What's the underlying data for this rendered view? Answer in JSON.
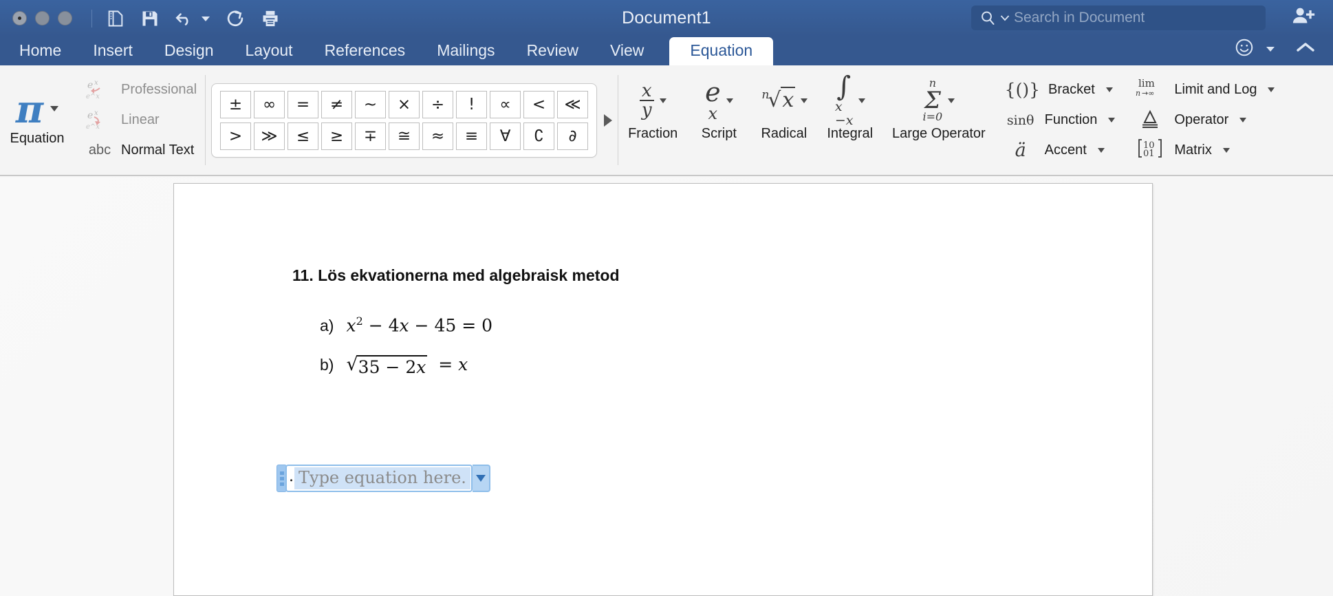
{
  "titlebar": {
    "document_title": "Document1",
    "window_controls": [
      "close",
      "minimize",
      "zoom"
    ],
    "quick_access": [
      {
        "name": "sidebar-toggle-icon",
        "label": "Sidebar"
      },
      {
        "name": "save-icon",
        "label": "Save"
      },
      {
        "name": "undo-icon",
        "label": "Undo"
      },
      {
        "name": "undo-dropdown-icon",
        "label": "Undo options"
      },
      {
        "name": "redo-icon",
        "label": "Redo"
      },
      {
        "name": "print-icon",
        "label": "Print"
      }
    ],
    "search": {
      "placeholder": "Search in Document",
      "value": "",
      "icon": "search-icon",
      "dropdown_icon": "chevron-down-icon"
    },
    "share_icon": "person-add-icon"
  },
  "tabs": {
    "items": [
      {
        "label": "Home",
        "active": false
      },
      {
        "label": "Insert",
        "active": false
      },
      {
        "label": "Design",
        "active": false
      },
      {
        "label": "Layout",
        "active": false
      },
      {
        "label": "References",
        "active": false
      },
      {
        "label": "Mailings",
        "active": false
      },
      {
        "label": "Review",
        "active": false
      },
      {
        "label": "View",
        "active": false
      },
      {
        "label": "Equation",
        "active": true
      }
    ],
    "right_icons": [
      {
        "name": "smiley-feedback-icon"
      },
      {
        "name": "chevron-down-icon"
      },
      {
        "name": "ribbon-collapse-chevron-icon"
      }
    ]
  },
  "ribbon": {
    "tools_group": {
      "equation_button": {
        "label": "Equation",
        "glyph": "π",
        "has_dropdown": true
      },
      "conversions": [
        {
          "label": "Professional",
          "icon": "professional-convert-icon",
          "enabled": false
        },
        {
          "label": "Linear",
          "icon": "linear-convert-icon",
          "enabled": false
        },
        {
          "label": "Normal Text",
          "icon": "abc-icon",
          "enabled": true
        }
      ]
    },
    "symbols_group": {
      "row1": [
        "±",
        "∞",
        "=",
        "≠",
        "~",
        "×",
        "÷",
        "!",
        "∝",
        "<",
        "≪"
      ],
      "row2": [
        ">",
        "≫",
        "≤",
        "≥",
        "∓",
        "≅",
        "≈",
        "≡",
        "∀",
        "∁",
        "∂"
      ],
      "more_icon": "gallery-more-arrow-icon"
    },
    "structures_group": {
      "large_buttons": [
        {
          "label": "Fraction",
          "glyph_type": "fraction",
          "numerator": "x",
          "denominator": "y",
          "has_dropdown": true
        },
        {
          "label": "Script",
          "glyph_type": "superscript",
          "base": "e",
          "exponent": "x",
          "has_dropdown": true
        },
        {
          "label": "Radical",
          "glyph_type": "radical",
          "index": "n",
          "radicand": "x",
          "has_dropdown": true
        },
        {
          "label": "Integral",
          "glyph_type": "integral",
          "upper": "x",
          "lower": "−x",
          "has_dropdown": true
        },
        {
          "label": "Large Operator",
          "glyph_type": "summation",
          "upper": "n",
          "lower": "i=0",
          "has_dropdown": true
        }
      ],
      "small_buttons": [
        {
          "label": "Bracket",
          "icon": "{()}",
          "has_dropdown": true
        },
        {
          "label": "Function",
          "icon": "sinθ",
          "has_dropdown": true
        },
        {
          "label": "Accent",
          "icon": "ä",
          "has_dropdown": true
        },
        {
          "label": "Limit and Log",
          "icon": "lim n→∞",
          "has_dropdown": true
        },
        {
          "label": "Operator",
          "icon": "≙",
          "has_dropdown": true
        },
        {
          "label": "Matrix",
          "icon": "[10 01]",
          "has_dropdown": true
        }
      ]
    }
  },
  "document": {
    "heading": "11. Lös ekvationerna med algebraisk metod",
    "items": [
      {
        "marker": "a)",
        "equation": "x² − 4x − 45 = 0"
      },
      {
        "marker": "b)",
        "equation": "√(35 − 2x) = x"
      }
    ],
    "equation_field": {
      "placeholder": "Type equation here.",
      "selected": true,
      "dropdown_icon": "equation-options-chevron-icon",
      "handle_icon": "equation-drag-handle-icon"
    }
  },
  "colors": {
    "titlebar": "#35588f",
    "ribbon_bg": "#f4f4f4",
    "active_tab_text": "#2b5797",
    "accent_pi": "#3f7fc1",
    "selection_blue": "#cfe2f7",
    "page_bg": "#ffffff"
  }
}
